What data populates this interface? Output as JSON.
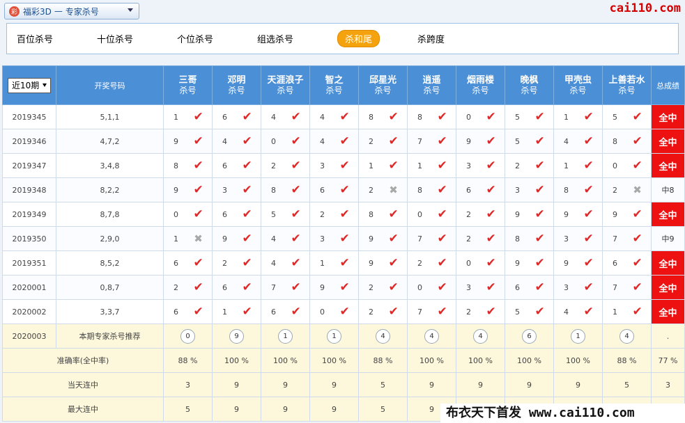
{
  "header": {
    "lottery_name": "福彩3D",
    "dash": "—",
    "section_name": "专家杀号",
    "icon_glyph": "彩",
    "site_logo": "cai110.com"
  },
  "tabs": [
    {
      "label": "百位杀号",
      "active": false
    },
    {
      "label": "十位杀号",
      "active": false
    },
    {
      "label": "个位杀号",
      "active": false
    },
    {
      "label": "组选杀号",
      "active": false
    },
    {
      "label": "杀和尾",
      "active": true
    },
    {
      "label": "杀跨度",
      "active": false
    }
  ],
  "table": {
    "period_select": "近10期",
    "draw_header": "开奖号码",
    "result_header": "总成绩",
    "expert_suffix": "杀号",
    "experts": [
      "三哥",
      "邓明",
      "天涯浪子",
      "智之",
      "邱星光",
      "逍遥",
      "烟雨楼",
      "晚枫",
      "甲壳虫",
      "上善若水"
    ],
    "rows": [
      {
        "period": "2019345",
        "draw": "5,1,1",
        "picks": [
          "1",
          "6",
          "4",
          "4",
          "8",
          "8",
          "0",
          "5",
          "1",
          "5"
        ],
        "hits": [
          true,
          true,
          true,
          true,
          true,
          true,
          true,
          true,
          true,
          true
        ],
        "result": "全中"
      },
      {
        "period": "2019346",
        "draw": "4,7,2",
        "picks": [
          "9",
          "4",
          "0",
          "4",
          "2",
          "7",
          "9",
          "5",
          "4",
          "8"
        ],
        "hits": [
          true,
          true,
          true,
          true,
          true,
          true,
          true,
          true,
          true,
          true
        ],
        "result": "全中"
      },
      {
        "period": "2019347",
        "draw": "3,4,8",
        "picks": [
          "8",
          "6",
          "2",
          "3",
          "1",
          "1",
          "3",
          "2",
          "1",
          "0"
        ],
        "hits": [
          true,
          true,
          true,
          true,
          true,
          true,
          true,
          true,
          true,
          true
        ],
        "result": "全中"
      },
      {
        "period": "2019348",
        "draw": "8,2,2",
        "picks": [
          "9",
          "3",
          "8",
          "6",
          "2",
          "8",
          "6",
          "3",
          "8",
          "2"
        ],
        "hits": [
          true,
          true,
          true,
          true,
          false,
          true,
          true,
          true,
          true,
          false
        ],
        "result": "中8"
      },
      {
        "period": "2019349",
        "draw": "8,7,8",
        "picks": [
          "0",
          "6",
          "5",
          "2",
          "8",
          "0",
          "2",
          "9",
          "9",
          "9"
        ],
        "hits": [
          true,
          true,
          true,
          true,
          true,
          true,
          true,
          true,
          true,
          true
        ],
        "result": "全中"
      },
      {
        "period": "2019350",
        "draw": "2,9,0",
        "picks": [
          "1",
          "9",
          "4",
          "3",
          "9",
          "7",
          "2",
          "8",
          "3",
          "7"
        ],
        "hits": [
          false,
          true,
          true,
          true,
          true,
          true,
          true,
          true,
          true,
          true
        ],
        "result": "中9"
      },
      {
        "period": "2019351",
        "draw": "8,5,2",
        "picks": [
          "6",
          "2",
          "4",
          "1",
          "9",
          "2",
          "0",
          "9",
          "9",
          "6"
        ],
        "hits": [
          true,
          true,
          true,
          true,
          true,
          true,
          true,
          true,
          true,
          true
        ],
        "result": "全中"
      },
      {
        "period": "2020001",
        "draw": "0,8,7",
        "picks": [
          "2",
          "6",
          "7",
          "9",
          "2",
          "0",
          "3",
          "6",
          "3",
          "7"
        ],
        "hits": [
          true,
          true,
          true,
          true,
          true,
          true,
          true,
          true,
          true,
          true
        ],
        "result": "全中"
      },
      {
        "period": "2020002",
        "draw": "3,3,7",
        "picks": [
          "6",
          "1",
          "6",
          "0",
          "2",
          "7",
          "2",
          "5",
          "4",
          "1"
        ],
        "hits": [
          true,
          true,
          true,
          true,
          true,
          true,
          true,
          true,
          true,
          true
        ],
        "result": "全中"
      }
    ],
    "recommend": {
      "period": "2020003",
      "label": "本期专家杀号推荐",
      "picks": [
        "0",
        "9",
        "1",
        "1",
        "4",
        "4",
        "4",
        "6",
        "1",
        "4"
      ],
      "result": "."
    },
    "accuracy": {
      "label": "准确率(全中率)",
      "values": [
        "88 %",
        "100 %",
        "100 %",
        "100 %",
        "88 %",
        "100 %",
        "100 %",
        "100 %",
        "100 %",
        "88 %"
      ],
      "total": "77 %"
    },
    "streak_today": {
      "label": "当天连中",
      "values": [
        "3",
        "9",
        "9",
        "9",
        "5",
        "9",
        "9",
        "9",
        "9",
        "5"
      ],
      "total": "3"
    },
    "streak_max": {
      "label": "最大连中",
      "values": [
        "5",
        "9",
        "9",
        "9",
        "5",
        "9"
      ]
    }
  },
  "watermark": "布衣天下首发 www.cai110.com",
  "colors": {
    "header_blue": "#4b8fd6",
    "hit_red": "#ee1111",
    "active_tab": "#f4a20d",
    "summary_bg": "#fdf8dc"
  }
}
